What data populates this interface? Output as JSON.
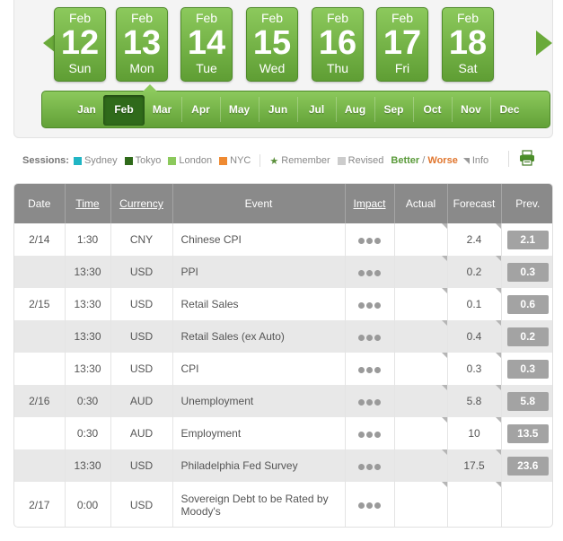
{
  "days": [
    {
      "month": "Feb",
      "num": "12",
      "weekday": "Sun"
    },
    {
      "month": "Feb",
      "num": "13",
      "weekday": "Mon"
    },
    {
      "month": "Feb",
      "num": "14",
      "weekday": "Tue"
    },
    {
      "month": "Feb",
      "num": "15",
      "weekday": "Wed"
    },
    {
      "month": "Feb",
      "num": "16",
      "weekday": "Thu"
    },
    {
      "month": "Feb",
      "num": "17",
      "weekday": "Fri"
    },
    {
      "month": "Feb",
      "num": "18",
      "weekday": "Sat"
    }
  ],
  "months": [
    "Jan",
    "Feb",
    "Mar",
    "Apr",
    "May",
    "Jun",
    "Jul",
    "Aug",
    "Sep",
    "Oct",
    "Nov",
    "Dec"
  ],
  "selected_month": "Feb",
  "legend": {
    "sessions_label": "Sessions:",
    "sessions": [
      {
        "name": "Sydney",
        "color": "#21b5c4"
      },
      {
        "name": "Tokyo",
        "color": "#2f6a1a"
      },
      {
        "name": "London",
        "color": "#8cc95c"
      },
      {
        "name": "NYC",
        "color": "#ef8a32"
      }
    ],
    "remember": "Remember",
    "revised": "Revised",
    "better": "Better",
    "slash": "/",
    "worse": "Worse",
    "info": "Info"
  },
  "table": {
    "headers": {
      "date": "Date",
      "time": "Time",
      "currency": "Currency",
      "event": "Event",
      "impact": "Impact",
      "actual": "Actual",
      "forecast": "Forecast",
      "prev": "Prev."
    },
    "rows": [
      {
        "date": "2/14",
        "time": "1:30",
        "currency": "CNY",
        "event": "Chinese CPI",
        "actual": "",
        "forecast": "2.4",
        "prev": "2.1"
      },
      {
        "date": "",
        "time": "13:30",
        "currency": "USD",
        "event": "PPI",
        "actual": "",
        "forecast": "0.2",
        "prev": "0.3"
      },
      {
        "date": "2/15",
        "time": "13:30",
        "currency": "USD",
        "event": "Retail Sales",
        "actual": "",
        "forecast": "0.1",
        "prev": "0.6"
      },
      {
        "date": "",
        "time": "13:30",
        "currency": "USD",
        "event": "Retail Sales (ex Auto)",
        "actual": "",
        "forecast": "0.4",
        "prev": "0.2"
      },
      {
        "date": "",
        "time": "13:30",
        "currency": "USD",
        "event": "CPI",
        "actual": "",
        "forecast": "0.3",
        "prev": "0.3"
      },
      {
        "date": "2/16",
        "time": "0:30",
        "currency": "AUD",
        "event": "Unemployment",
        "actual": "",
        "forecast": "5.8",
        "prev": "5.8"
      },
      {
        "date": "",
        "time": "0:30",
        "currency": "AUD",
        "event": "Employment",
        "actual": "",
        "forecast": "10",
        "prev": "13.5"
      },
      {
        "date": "",
        "time": "13:30",
        "currency": "USD",
        "event": "Philadelphia Fed Survey",
        "actual": "",
        "forecast": "17.5",
        "prev": "23.6"
      },
      {
        "date": "2/17",
        "time": "0:00",
        "currency": "USD",
        "event": "Sovereign Debt to be Rated by Moody's",
        "actual": "",
        "forecast": "",
        "prev": ""
      }
    ]
  }
}
